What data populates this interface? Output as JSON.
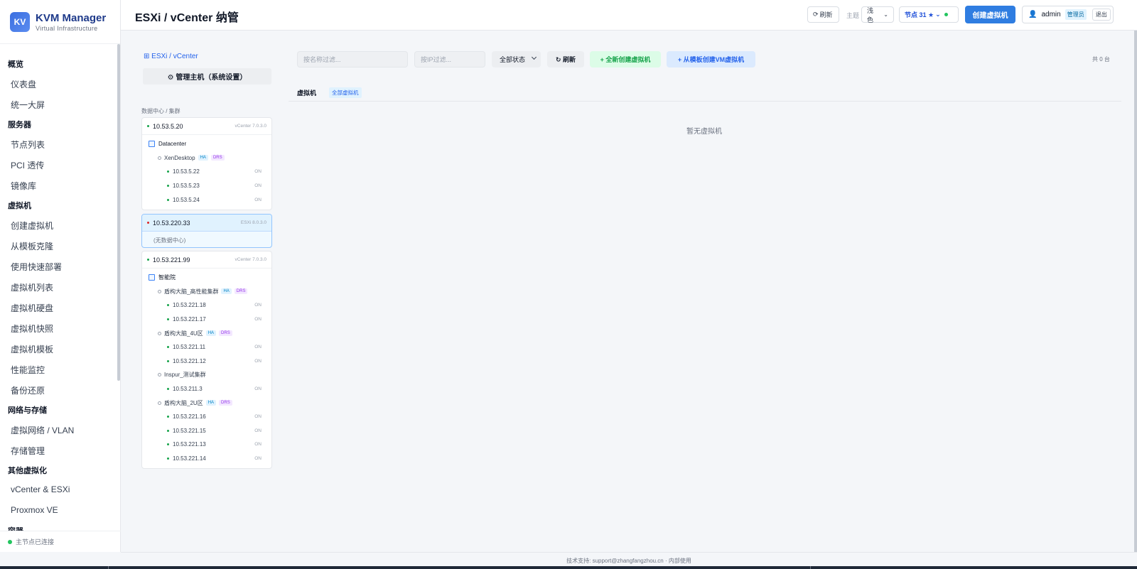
{
  "brand": {
    "logo": "KV",
    "name": "KVM Manager",
    "subtitle": "Virtual Infrastructure"
  },
  "nav": [
    {
      "group": "概览",
      "items": [
        "仪表盘",
        "统一大屏"
      ]
    },
    {
      "group": "服务器",
      "items": [
        "节点列表",
        "PCI 透传",
        "镜像库"
      ]
    },
    {
      "group": "虚拟机",
      "items": [
        "创建虚拟机",
        "从模板克隆",
        "使用快速部署",
        "虚拟机列表",
        "虚拟机硬盘",
        "虚拟机快照",
        "虚拟机模板",
        "性能监控",
        "备份还原"
      ]
    },
    {
      "group": "网络与存储",
      "items": [
        "虚拟网络 / VLAN",
        "存储管理"
      ]
    },
    {
      "group": "其他虚拟化",
      "items": [
        "vCenter & ESXi",
        "Proxmox VE"
      ]
    },
    {
      "group": "容器",
      "items": []
    }
  ],
  "sidebar_status": "主节点已连接",
  "header": {
    "title": "ESXi / vCenter 纳管",
    "refresh": "刷新",
    "theme_label": "主题",
    "theme_value": "浅色",
    "node_selector": "节点 31 ★",
    "create_vm": "创建虚拟机",
    "user": "admin",
    "role": "管理员",
    "logout": "退出"
  },
  "tree": {
    "breadcrumb": "ESXi / vCenter",
    "manage_button": "⚙ 管理主机（系统设置）",
    "section_label": "数据中心 / 集群",
    "hosts": [
      {
        "name": "10.53.5.20",
        "version": "vCenter 7.0.3.0",
        "status_color": "#16a34a",
        "datacenter": "Datacenter",
        "clusters": [
          {
            "name": "XenDesktop",
            "ha": "HA",
            "drs": "DRS",
            "hosts": [
              {
                "ip": "10.53.5.22",
                "state": "ON"
              },
              {
                "ip": "10.53.5.23",
                "state": "ON"
              },
              {
                "ip": "10.53.5.24",
                "state": "ON"
              }
            ]
          }
        ]
      },
      {
        "name": "10.53.220.33",
        "version": "ESXi 8.0.3.0",
        "status_color": "#dc2626",
        "no_datacenter": "(无数据中心)"
      },
      {
        "name": "10.53.221.99",
        "version": "vCenter 7.0.3.0",
        "status_color": "#16a34a",
        "datacenter": "智能院",
        "clusters": [
          {
            "name": "盾构大脑_高性能集群",
            "ha": "HA",
            "drs": "DRS",
            "hosts": [
              {
                "ip": "10.53.221.18",
                "state": "ON"
              },
              {
                "ip": "10.53.221.17",
                "state": "ON"
              }
            ]
          },
          {
            "name": "盾构大脑_4U区",
            "ha": "HA",
            "drs": "DRS",
            "hosts": [
              {
                "ip": "10.53.221.11",
                "state": "ON"
              },
              {
                "ip": "10.53.221.12",
                "state": "ON"
              }
            ]
          },
          {
            "name": "Inspur_测试集群",
            "ha": "",
            "drs": "",
            "hosts": [
              {
                "ip": "10.53.211.3",
                "state": "ON"
              }
            ]
          },
          {
            "name": "盾构大脑_2U区",
            "ha": "HA",
            "drs": "DRS",
            "hosts": [
              {
                "ip": "10.53.221.16",
                "state": "ON"
              },
              {
                "ip": "10.53.221.15",
                "state": "ON"
              },
              {
                "ip": "10.53.221.13",
                "state": "ON"
              },
              {
                "ip": "10.53.221.14",
                "state": "ON"
              }
            ]
          }
        ]
      }
    ]
  },
  "main": {
    "name_filter_placeholder": "按名称过滤...",
    "ip_filter_placeholder": "按IP过滤...",
    "status_filter": "全部状态",
    "refresh": "↻ 刷新",
    "new_vm": "+ 全新创建虚拟机",
    "template_vm": "+ 从模板创建VM虚拟机",
    "count": "共 0 台",
    "tab_vm": "虚拟机",
    "tab_all": "全部虚拟机",
    "empty": "暂无虚拟机"
  },
  "footer": "技术支持: support@zhangfangzhou.cn · 内部使用"
}
